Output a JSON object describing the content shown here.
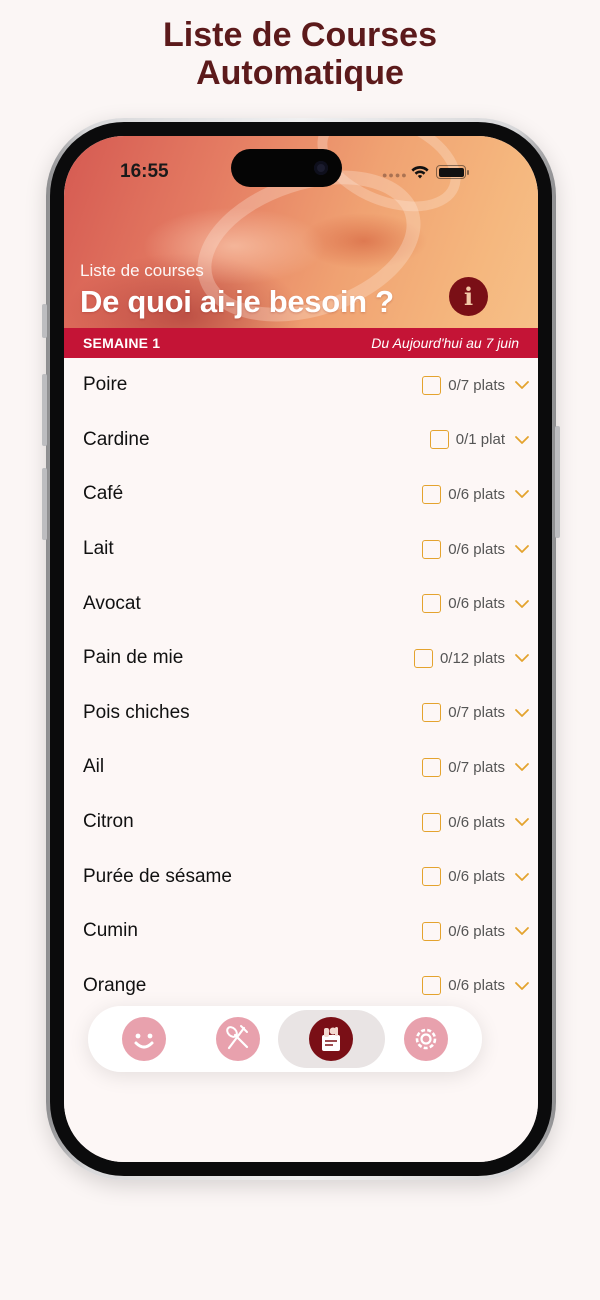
{
  "promo": {
    "title_line1": "Liste de Courses",
    "title_line2": "Automatique"
  },
  "status_bar": {
    "time": "16:55"
  },
  "header": {
    "subtitle": "Liste de courses",
    "title": "De quoi ai-je besoin ?",
    "info_label": "i"
  },
  "week_bar": {
    "label": "SEMAINE 1",
    "range": "Du Aujourd'hui au 7 juin"
  },
  "items": [
    {
      "name": "Poire",
      "count": "0/7 plats"
    },
    {
      "name": "Cardine",
      "count": "0/1 plat"
    },
    {
      "name": "Café",
      "count": "0/6 plats"
    },
    {
      "name": "Lait",
      "count": "0/6 plats"
    },
    {
      "name": "Avocat",
      "count": "0/6 plats"
    },
    {
      "name": "Pain de mie",
      "count": "0/12 plats"
    },
    {
      "name": "Pois chiches",
      "count": "0/7 plats"
    },
    {
      "name": "Ail",
      "count": "0/7 plats"
    },
    {
      "name": "Citron",
      "count": "0/6 plats"
    },
    {
      "name": "Purée de sésame",
      "count": "0/6 plats"
    },
    {
      "name": "Cumin",
      "count": "0/6 plats"
    },
    {
      "name": "Orange",
      "count": "0/6 plats"
    }
  ],
  "tabbar": {
    "tabs": [
      {
        "icon": "smiley-face-icon",
        "active": false
      },
      {
        "icon": "fork-spoon-icon",
        "active": false
      },
      {
        "icon": "grocery-bag-icon",
        "active": true
      },
      {
        "icon": "gear-icon",
        "active": false
      }
    ]
  },
  "colors": {
    "brand_dark": "#7a0f16",
    "week_bar": "#c41436",
    "checkbox": "#e4a32e",
    "tab_inactive": "#e8a1ad",
    "promo_title": "#5c1a1b"
  }
}
